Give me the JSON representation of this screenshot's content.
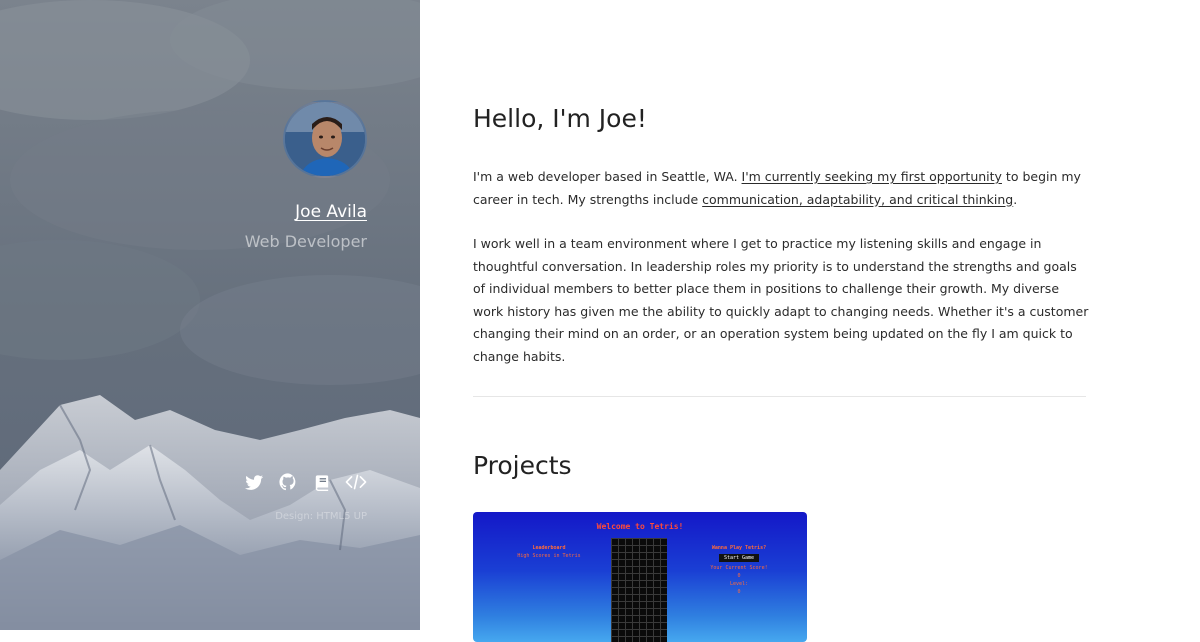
{
  "sidebar": {
    "name": "Joe Avila",
    "role": "Web Developer",
    "credit": "Design: HTML5 UP",
    "social": [
      {
        "icon": "twitter-icon"
      },
      {
        "icon": "github-icon"
      },
      {
        "icon": "book-icon"
      },
      {
        "icon": "code-icon"
      }
    ]
  },
  "main": {
    "heading": "Hello, I'm Joe!",
    "intro": {
      "text1": "I'm a web developer based in Seattle, WA. ",
      "link1": "I'm currently seeking my first opportunity",
      "text2": " to begin my career in tech. My strengths include ",
      "link2": "communication, adaptability, and critical thinking",
      "text3": "."
    },
    "paragraph2": "I work well in a team environment where I get to practice my listening skills and engage in thoughtful conversation. In leadership roles my priority is to understand the strengths and goals of individual members to better place them in positions to challenge their growth. My diverse work history has given me the ability to quickly adapt to changing needs. Whether it's a customer changing their mind on an order, or an operation system being updated on the fly I am quick to change habits.",
    "projects_heading": "Projects",
    "project_preview": {
      "title": "Welcome to Tetris!",
      "left_title": "Leaderboard",
      "left_subtitle": "High Scores in Tetris",
      "right_title": "Wanna Play Tetris?",
      "start_label": "Start Game",
      "score_label": "Your Current Score!",
      "score_value": "0",
      "level_label": "Level:",
      "level_value": "0"
    }
  },
  "colors": {
    "sidebar_bg": "#5d6878",
    "text": "#2b2b2b",
    "divider": "#e6e6e6"
  }
}
